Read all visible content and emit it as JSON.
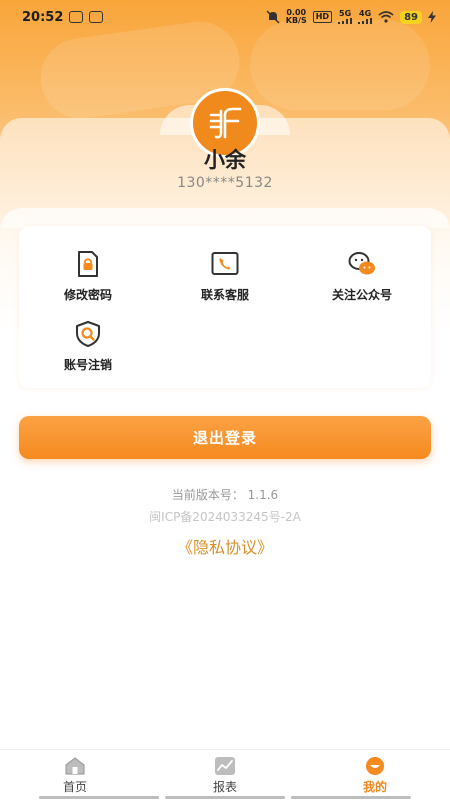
{
  "status_bar": {
    "time": "20:52",
    "net_speed_value": "0.00",
    "net_speed_unit": "KB/S",
    "hd_label": "HD",
    "sig1_label": "5G",
    "sig2_label": "4G",
    "battery": "89"
  },
  "profile": {
    "name": "小余",
    "phone": "130****5132",
    "avatar_icon": "brand-logo-icon"
  },
  "menu": {
    "items": [
      {
        "label": "修改密码",
        "icon": "document-lock-icon"
      },
      {
        "label": "联系客服",
        "icon": "phone-icon"
      },
      {
        "label": "关注公众号",
        "icon": "wechat-icon"
      },
      {
        "label": "账号注销",
        "icon": "shield-search-icon"
      }
    ]
  },
  "logout_label": "退出登录",
  "footer": {
    "version": "当前版本号： 1.1.6",
    "icp": "闽ICP备2024033245号-2A",
    "privacy": "《隐私协议》"
  },
  "tabs": [
    {
      "label": "首页",
      "icon": "home-icon",
      "active": false
    },
    {
      "label": "报表",
      "icon": "chart-icon",
      "active": false
    },
    {
      "label": "我的",
      "icon": "profile-icon",
      "active": true
    }
  ],
  "colors": {
    "accent": "#f68a1f",
    "link": "#d9902a"
  }
}
